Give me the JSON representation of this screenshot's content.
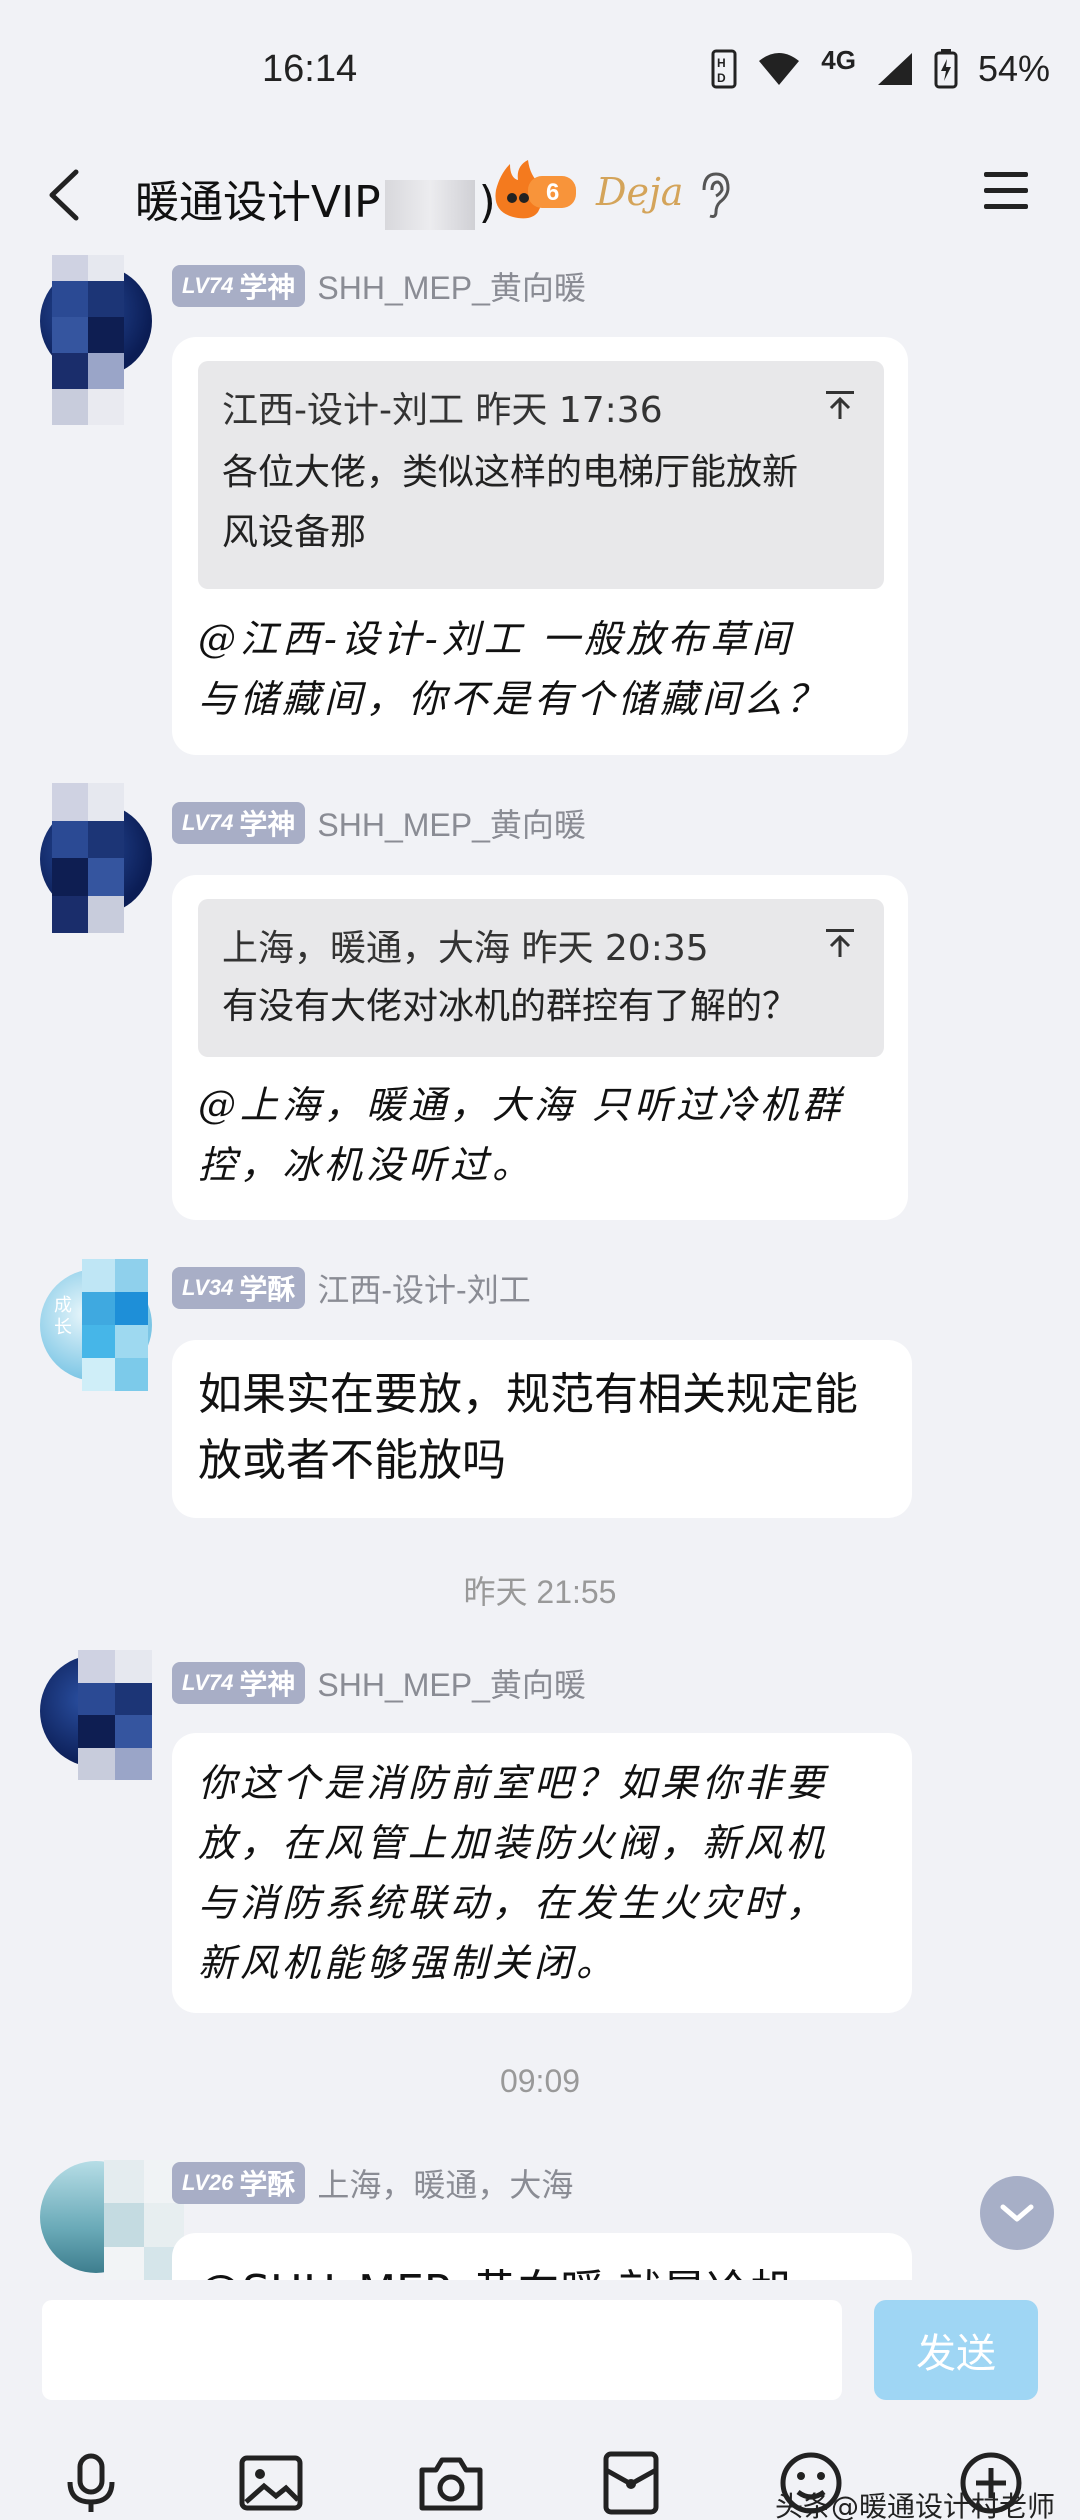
{
  "status_bar": {
    "time": "16:14",
    "network": "4G",
    "battery": "54%"
  },
  "header": {
    "title_prefix": "暖通设计VIP",
    "title_suffix": ")",
    "fire_level": "6",
    "badge_text": "Deja",
    "icons": [
      "back-icon",
      "fire-badge-icon",
      "ear-icon",
      "menu-icon"
    ]
  },
  "messages": [
    {
      "level": "LV74",
      "rank": "学神",
      "sender": "SHH_MEP_黄向暖",
      "quote_author_time": "江西-设计-刘工 昨天 17:36",
      "quote_lines": [
        "各位大佬，类似这样的电梯厅能放新",
        "风设备那"
      ],
      "text_lines": [
        "@江西-设计-刘工 一般放布草间",
        "与储藏间，你不是有个储藏间么？"
      ]
    },
    {
      "level": "LV74",
      "rank": "学神",
      "sender": "SHH_MEP_黄向暖",
      "quote_author_time": "上海，暖通，大海 昨天 20:35",
      "quote_lines": [
        "有没有大佬对冰机的群控有了解的？"
      ],
      "text_lines": [
        "@上海，暖通，大海 只听过冷机群",
        "控，冰机没听过。"
      ]
    },
    {
      "level": "LV34",
      "rank": "学酥",
      "sender": "江西-设计-刘工",
      "avatar_text": "成长",
      "text_lines": [
        "如果实在要放，规范有相关规定能",
        "放或者不能放吗"
      ]
    },
    {
      "level": "LV74",
      "rank": "学神",
      "sender": "SHH_MEP_黄向暖",
      "text_lines": [
        "你这个是消防前室吧？如果你非要",
        "放，在风管上加装防火阀，新风机",
        "与消防系统联动，在发生火灾时，",
        "新风机能够强制关闭。"
      ]
    },
    {
      "level": "LV26",
      "rank": "学酥",
      "sender": "上海，暖通，大海",
      "text_lines": [
        "@SHH_MEP_黄向暖 就是冷机"
      ]
    }
  ],
  "timestamps": {
    "t1": "昨天 21:55",
    "t2": "09:09"
  },
  "input": {
    "placeholder": "",
    "send_label": "发送"
  },
  "toolbar": [
    "microphone-icon",
    "image-icon",
    "camera-icon",
    "red-packet-icon",
    "emoji-icon",
    "plus-icon"
  ],
  "watermark": "头条@暖通设计村老师",
  "colors": {
    "background": "#f1f2f6",
    "level_badge": "#a8aec6",
    "send_button": "#9fd6f4",
    "quote_bg": "#e8e8ea"
  }
}
